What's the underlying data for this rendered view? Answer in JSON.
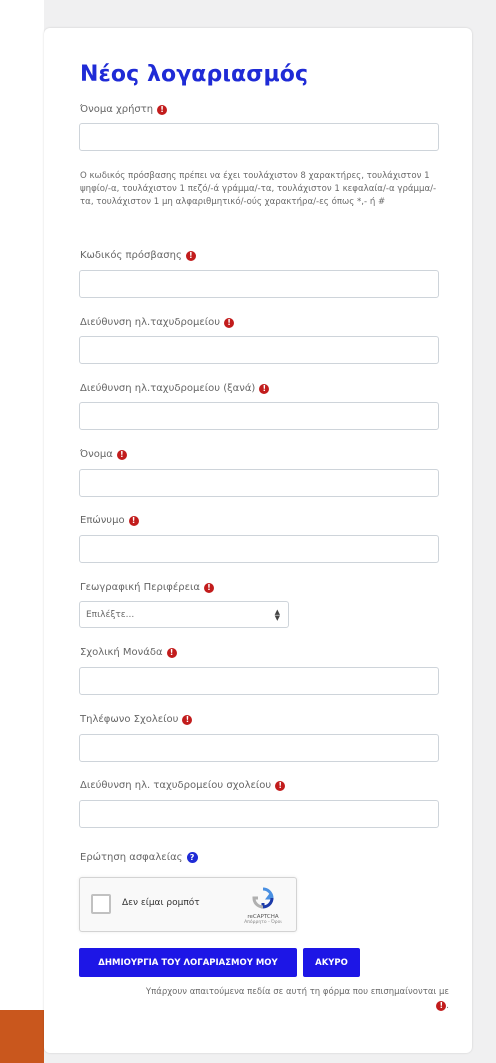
{
  "form": {
    "title": "Νέος λογαριασμός",
    "required_mark": "!",
    "help_mark": "?",
    "fields": {
      "username": {
        "label": "Όνομα χρήστη"
      },
      "password_hint": "Ο κωδικός πρόσβασης πρέπει να έχει τουλάχιστον 8 χαρακτήρες, τουλάχιστον 1 ψηφίο/-α, τουλάχιστον 1 πεζό/-ά γράμμα/-τα, τουλάχιστον 1 κεφαλαία/-α γράμμα/-τα, τουλάχιστον 1 μη αλφαριθμητικό/-ούς χαρακτήρα/-ες όπως *,- ή #",
      "password": {
        "label": "Κωδικός πρόσβασης"
      },
      "email": {
        "label": "Διεύθυνση ηλ.ταχυδρομείου"
      },
      "email_again": {
        "label": "Διεύθυνση ηλ.ταχυδρομείου (ξανά)"
      },
      "first_name": {
        "label": "Όνομα"
      },
      "last_name": {
        "label": "Επώνυμο"
      },
      "region": {
        "label": "Γεωγραφική Περιφέρεια",
        "selected": "Επιλέξτε..."
      },
      "school_unit": {
        "label": "Σχολική Μονάδα"
      },
      "school_phone": {
        "label": "Τηλέφωνο Σχολείου"
      },
      "school_email": {
        "label": "Διεύθυνση ηλ. ταχυδρομείου σχολείου"
      },
      "security_question": {
        "label": "Ερώτηση ασφαλείας"
      }
    },
    "captcha": {
      "text": "Δεν είμαι ρομπότ",
      "brand": "reCAPTCHA",
      "links": "Απόρρητο - Όροι"
    },
    "buttons": {
      "create": "ΔΗΜΙΟΥΡΓΙΑ ΤΟΥ ΛΟΓΑΡΙΑΣΜΟΥ ΜΟΥ",
      "cancel": "ΑΚΥΡΟ"
    },
    "footnote": "Υπάρχουν απαιτούμενα πεδία σε αυτή τη φόρμα που επισημαίνονται με",
    "footnote_end": "."
  },
  "colors": {
    "title": "#1f2bd6",
    "button": "#1d16e6",
    "required": "#c21c1c",
    "accent_block": "#c9571d"
  }
}
